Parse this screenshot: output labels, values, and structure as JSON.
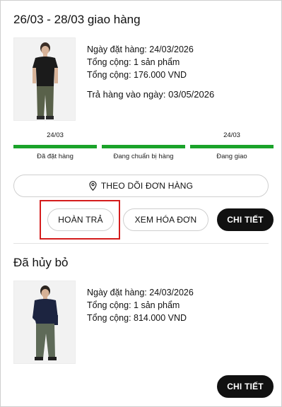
{
  "orders": [
    {
      "title": "26/03 - 28/03 giao hàng",
      "info": {
        "order_date": "Ngày đặt hàng: 24/03/2026",
        "item_count": "Tổng cộng: 1 sản phẩm",
        "total": "Tổng cộng: 176.000 VND",
        "return_by": "Trả hàng vào ngày: 03/05/2026"
      },
      "steps": [
        {
          "date": "24/03",
          "label": "Đã đặt hàng",
          "complete": 1
        },
        {
          "date": "",
          "label": "Đang chuẩn bị hàng",
          "complete": 1
        },
        {
          "date": "24/03",
          "label": "Đang giao",
          "complete": 1
        }
      ],
      "track_label": "THEO DÕI ĐƠN HÀNG",
      "return_label": "HOÀN TRẢ",
      "invoice_label": "XEM HÓA ĐƠN",
      "detail_label": "CHI TIẾT"
    },
    {
      "title": "Đã hủy bỏ",
      "info": {
        "order_date": "Ngày đặt hàng: 24/03/2026",
        "item_count": "Tổng cộng: 1 sản phẩm",
        "total": "Tổng cộng: 814.000 VND"
      },
      "detail_label": "CHI TIẾT"
    }
  ],
  "colors": {
    "progress": "#1aa32a",
    "highlight": "#d41c1c",
    "primary_button": "#111111"
  },
  "icons": {
    "track": "location-pin-icon"
  }
}
